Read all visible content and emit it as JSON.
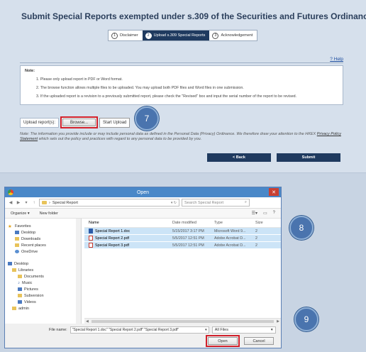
{
  "page": {
    "title": "Submit Special Reports exempted under s.309 of the Securities and Futures Ordinance",
    "steps": [
      {
        "num": "1",
        "label": "Disclaimer"
      },
      {
        "num": "2",
        "label": "Upload s.309 Special Reports"
      },
      {
        "num": "3",
        "label": "Acknowledgement"
      }
    ],
    "help": "? Help",
    "note_title": "Note:",
    "notes": [
      "1. Please only upload report in PDF or Word format.",
      "2. The browse function allows multiple files to be uploaded. You may upload both PDF files and Word files in one submission.",
      "3. If the uploaded report is a revision to a previously submitted report, please check the \"Revised\" box and input the serial number of the report to be revised."
    ],
    "upload_label": "Upload report(s):",
    "browse": "Browse...",
    "start_upload": "Start Upload",
    "disclaimer_a": "Note: The information you provide include or may include personal data as defined in the Personal Data (Privacy) Ordinance. We therefore draw your attention to the HKEX ",
    "disclaimer_link": "Privacy Policy Statement",
    "disclaimer_b": " which sets out the policy and practices with regard to any personal data to be provided by you.",
    "back": "< Back",
    "submit": "Submit"
  },
  "callouts": {
    "c7": "7",
    "c8": "8",
    "c9": "9"
  },
  "dialog": {
    "title": "Open",
    "close": "✕",
    "path_arrow": "›",
    "path": "Special Report",
    "search_placeholder": "Search Special Report",
    "organize": "Organize ▾",
    "new_folder": "New folder",
    "nav": {
      "favorites": "Favorites",
      "desktop": "Desktop",
      "downloads": "Downloads",
      "recent": "Recent places",
      "onedrive": "OneDrive",
      "desktop2": "Desktop",
      "libraries": "Libraries",
      "documents": "Documents",
      "music": "Music",
      "pictures": "Pictures",
      "subversion": "Subversion",
      "videos": "Videos",
      "admin": "admin"
    },
    "columns": {
      "name": "Name",
      "date": "Date modified",
      "type": "Type",
      "size": "Size"
    },
    "files": [
      {
        "name": "Special Report 1.doc",
        "date": "5/15/2017 3:17 PM",
        "type": "Microsoft Word 9...",
        "size": "2"
      },
      {
        "name": "Special Report 2.pdf",
        "date": "5/5/2017 12:51 PM",
        "type": "Adobe Acrobat D...",
        "size": "2"
      },
      {
        "name": "Special Report 3.pdf",
        "date": "5/5/2017 12:51 PM",
        "type": "Adobe Acrobat D...",
        "size": "2"
      }
    ],
    "filename_label": "File name:",
    "filename_value": "\"Special Report 1.doc\" \"Special Report 2.pdf\" \"Special Report 3.pdf\"",
    "filter": "All Files",
    "open": "Open",
    "cancel": "Cancel"
  },
  "colors": {
    "navy": "#1f3a5f",
    "highlight": "#d0202a",
    "callout": "#4a74ae"
  }
}
